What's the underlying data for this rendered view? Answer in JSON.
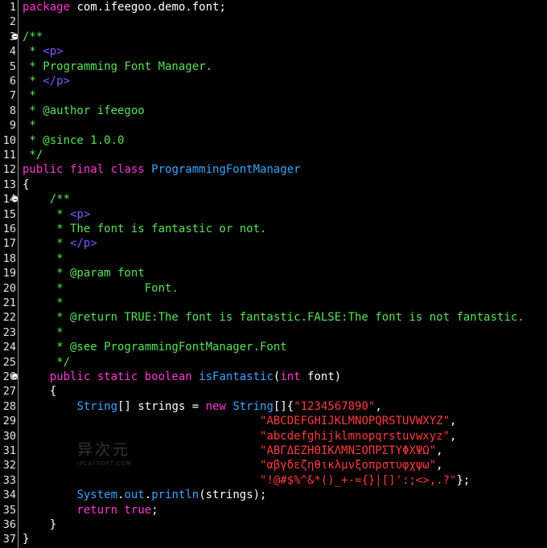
{
  "colors": {
    "keyword": "#ff36d6",
    "comment": "#54e454",
    "html_tag": "#7a5cff",
    "type": "#36a6ff",
    "string": "#ff3a3a",
    "plain": "#ffffff",
    "background": "#000000"
  },
  "fold_icon": "collapse-icon",
  "lines": [
    {
      "n": "1",
      "segs": [
        {
          "c": "kw",
          "t": "package"
        },
        {
          "c": "pl",
          "t": " com.ifeegoo.demo.font;"
        }
      ]
    },
    {
      "n": "2",
      "segs": []
    },
    {
      "n": "3",
      "fold": true,
      "segs": [
        {
          "c": "cm",
          "t": "/**"
        }
      ]
    },
    {
      "n": "4",
      "segs": [
        {
          "c": "cm",
          "t": " * "
        },
        {
          "c": "tg",
          "t": "<p>"
        }
      ]
    },
    {
      "n": "5",
      "segs": [
        {
          "c": "cm",
          "t": " * Programming Font Manager."
        }
      ]
    },
    {
      "n": "6",
      "segs": [
        {
          "c": "cm",
          "t": " * "
        },
        {
          "c": "tg",
          "t": "</p>"
        }
      ]
    },
    {
      "n": "7",
      "segs": [
        {
          "c": "cm",
          "t": " *"
        }
      ]
    },
    {
      "n": "8",
      "segs": [
        {
          "c": "cm",
          "t": " * @author ifeegoo"
        }
      ]
    },
    {
      "n": "9",
      "segs": [
        {
          "c": "cm",
          "t": " *"
        }
      ]
    },
    {
      "n": "10",
      "segs": [
        {
          "c": "cm",
          "t": " * @since 1.0.0"
        }
      ]
    },
    {
      "n": "11",
      "segs": [
        {
          "c": "cm",
          "t": " */"
        }
      ]
    },
    {
      "n": "12",
      "segs": [
        {
          "c": "kw",
          "t": "public final class"
        },
        {
          "c": "pl",
          "t": " "
        },
        {
          "c": "ty",
          "t": "ProgrammingFontManager"
        }
      ]
    },
    {
      "n": "13",
      "segs": [
        {
          "c": "pl",
          "t": "{"
        }
      ]
    },
    {
      "n": "14",
      "fold": true,
      "segs": [
        {
          "c": "cm",
          "t": "    /**"
        }
      ]
    },
    {
      "n": "15",
      "segs": [
        {
          "c": "cm",
          "t": "     * "
        },
        {
          "c": "tg",
          "t": "<p>"
        }
      ]
    },
    {
      "n": "16",
      "segs": [
        {
          "c": "cm",
          "t": "     * The font is fantastic or not."
        }
      ]
    },
    {
      "n": "17",
      "segs": [
        {
          "c": "cm",
          "t": "     * "
        },
        {
          "c": "tg",
          "t": "</p>"
        }
      ]
    },
    {
      "n": "18",
      "segs": [
        {
          "c": "cm",
          "t": "     *"
        }
      ]
    },
    {
      "n": "19",
      "segs": [
        {
          "c": "cm",
          "t": "     * @param font"
        }
      ]
    },
    {
      "n": "20",
      "segs": [
        {
          "c": "cm",
          "t": "     *            Font."
        }
      ]
    },
    {
      "n": "21",
      "segs": [
        {
          "c": "cm",
          "t": "     *"
        }
      ]
    },
    {
      "n": "22",
      "segs": [
        {
          "c": "cm",
          "t": "     * @return TRUE:The font is fantastic.FALSE:The font is not fantastic."
        }
      ]
    },
    {
      "n": "23",
      "segs": [
        {
          "c": "cm",
          "t": "     *"
        }
      ]
    },
    {
      "n": "24",
      "segs": [
        {
          "c": "cm",
          "t": "     * @see ProgrammingFontManager.Font"
        }
      ]
    },
    {
      "n": "25",
      "segs": [
        {
          "c": "cm",
          "t": "     */"
        }
      ]
    },
    {
      "n": "26",
      "fold": true,
      "segs": [
        {
          "c": "kw",
          "t": "    public static boolean"
        },
        {
          "c": "pl",
          "t": " "
        },
        {
          "c": "ty",
          "t": "isFantastic"
        },
        {
          "c": "pl",
          "t": "("
        },
        {
          "c": "kw",
          "t": "int"
        },
        {
          "c": "pl",
          "t": " font)"
        }
      ]
    },
    {
      "n": "27",
      "segs": [
        {
          "c": "pl",
          "t": "    {"
        }
      ]
    },
    {
      "n": "28",
      "segs": [
        {
          "c": "pl",
          "t": "        "
        },
        {
          "c": "ty",
          "t": "String"
        },
        {
          "c": "pl",
          "t": "[] strings = "
        },
        {
          "c": "kw",
          "t": "new"
        },
        {
          "c": "pl",
          "t": " "
        },
        {
          "c": "ty",
          "t": "String"
        },
        {
          "c": "pl",
          "t": "[]{"
        },
        {
          "c": "st",
          "t": "\"1234567890\""
        },
        {
          "c": "pl",
          "t": ","
        }
      ]
    },
    {
      "n": "29",
      "segs": [
        {
          "c": "pl",
          "t": "                                   "
        },
        {
          "c": "st",
          "t": "\"ABCDEFGHIJKLMNOPQRSTUVWXYZ\""
        },
        {
          "c": "pl",
          "t": ","
        }
      ]
    },
    {
      "n": "30",
      "segs": [
        {
          "c": "pl",
          "t": "                                   "
        },
        {
          "c": "st",
          "t": "\"abcdefghijklmnopqrstuvwxyz\""
        },
        {
          "c": "pl",
          "t": ","
        }
      ]
    },
    {
      "n": "31",
      "segs": [
        {
          "c": "pl",
          "t": "                                   "
        },
        {
          "c": "st",
          "t": "\"ΑΒΓΔΕΖΗΘΙΚΛΜΝΞΟΠΡΣΤΥΦΧΨΩ\""
        },
        {
          "c": "pl",
          "t": ","
        }
      ]
    },
    {
      "n": "32",
      "segs": [
        {
          "c": "pl",
          "t": "                                   "
        },
        {
          "c": "st",
          "t": "\"αβγδεζηθικλμνξοπρστυφχψω\""
        },
        {
          "c": "pl",
          "t": ","
        }
      ]
    },
    {
      "n": "33",
      "segs": [
        {
          "c": "pl",
          "t": "                                   "
        },
        {
          "c": "st",
          "t": "\"!@#$%^&*()_+-={}|[]':;<>,.?\""
        },
        {
          "c": "pl",
          "t": "};"
        }
      ]
    },
    {
      "n": "34",
      "segs": [
        {
          "c": "pl",
          "t": "        "
        },
        {
          "c": "ty",
          "t": "System"
        },
        {
          "c": "pl",
          "t": "."
        },
        {
          "c": "ty",
          "t": "out"
        },
        {
          "c": "pl",
          "t": "."
        },
        {
          "c": "ty",
          "t": "println"
        },
        {
          "c": "pl",
          "t": "(strings);"
        }
      ]
    },
    {
      "n": "35",
      "segs": [
        {
          "c": "kw",
          "t": "        return true"
        },
        {
          "c": "pl",
          "t": ";"
        }
      ]
    },
    {
      "n": "36",
      "segs": [
        {
          "c": "pl",
          "t": "    }"
        }
      ]
    },
    {
      "n": "37",
      "segs": [
        {
          "c": "pl",
          "t": "}"
        }
      ]
    }
  ],
  "watermark": {
    "main": "异次元",
    "sub": "IPLAYSOFT.COM"
  }
}
